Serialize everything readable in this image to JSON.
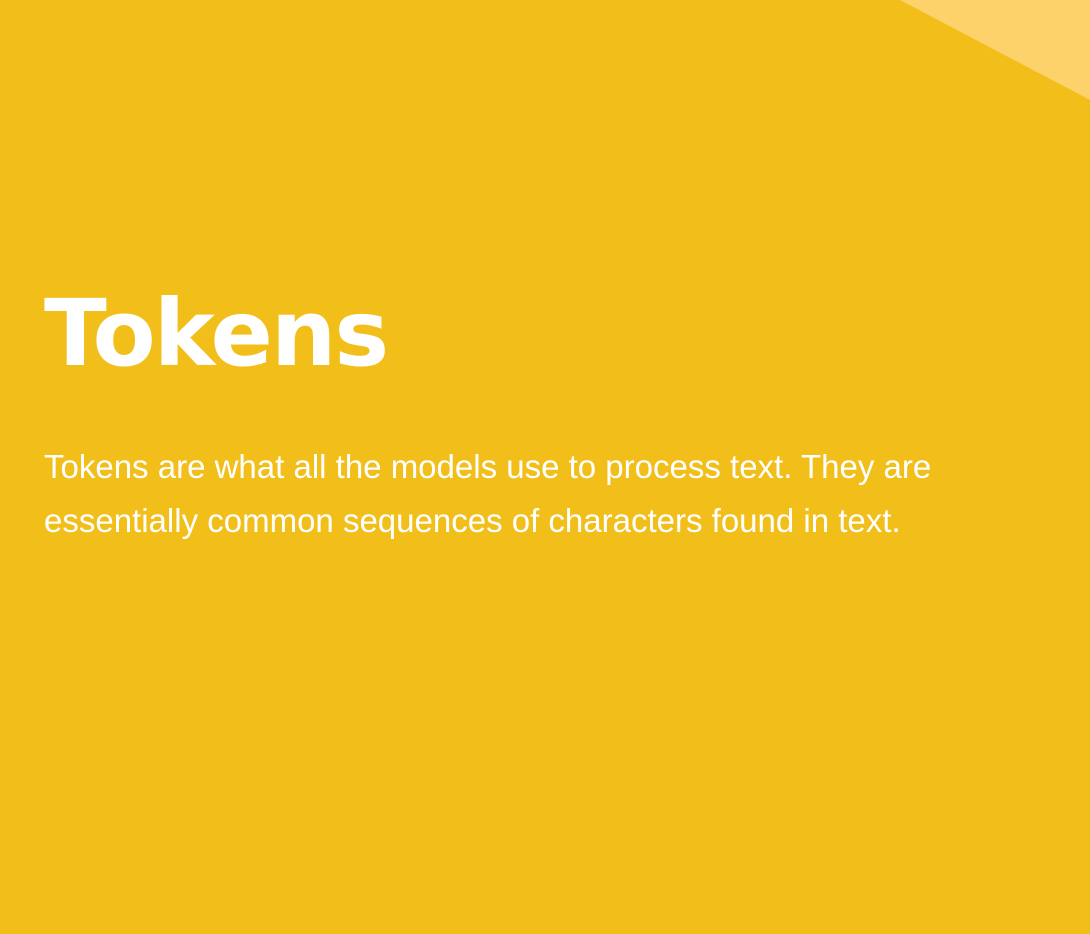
{
  "slide": {
    "title": "Tokens",
    "body": "Tokens are what all the models use to process text. They are essentially common sequences of characters found in text.",
    "colors": {
      "background": "#F2BE1A",
      "accent_shape": "#FDD26B",
      "text": "#FFFFFF"
    }
  }
}
